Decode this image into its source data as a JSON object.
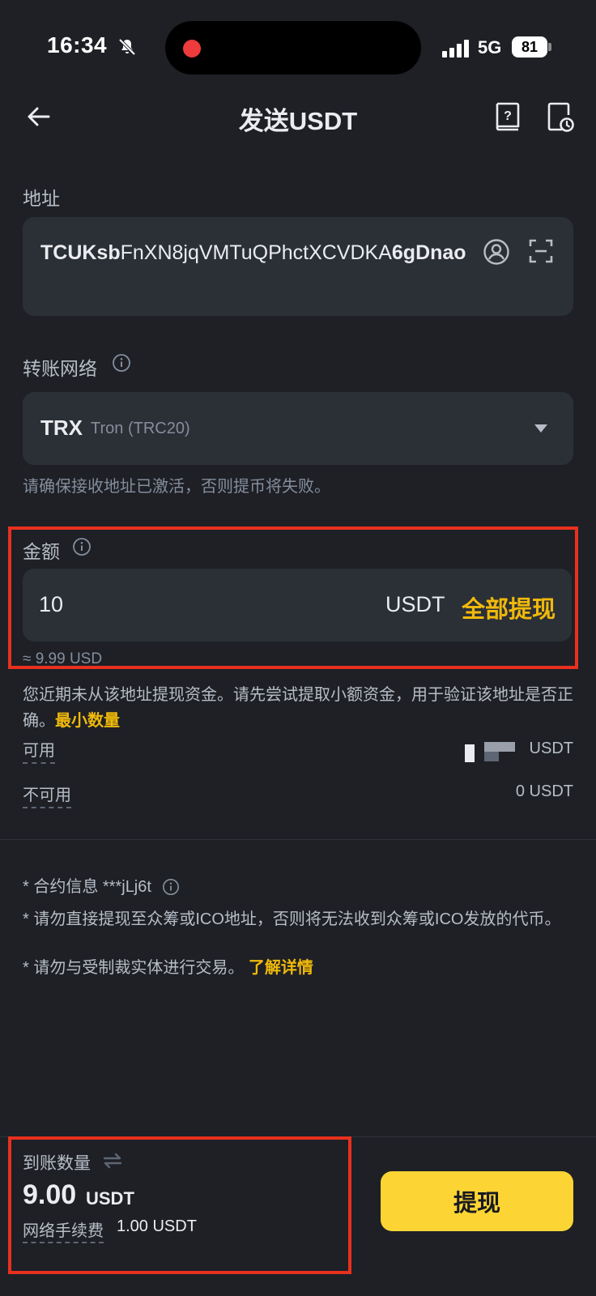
{
  "status_bar": {
    "time": "16:34",
    "network": "5G",
    "battery": "81",
    "icons": [
      "bell-off-icon",
      "recording-dot-icon",
      "signal-icon",
      "battery-icon"
    ]
  },
  "header": {
    "title": "发送USDT",
    "icons": [
      "back-arrow-icon",
      "help-book-icon",
      "history-icon"
    ]
  },
  "address": {
    "label": "地址",
    "value_prefix": "TCUKsb",
    "value_middle": "FnXN8jqVMTuQPhctXCVDKA",
    "value_suffix": "6gDnao",
    "icons": [
      "contact-icon",
      "scan-icon"
    ]
  },
  "network": {
    "label": "转账网络",
    "code": "TRX",
    "name": "Tron (TRC20)",
    "hint": "请确保接收地址已激活，否则提币将失败。"
  },
  "amount": {
    "label": "金额",
    "value": "10",
    "unit": "USDT",
    "max_label": "全部提现",
    "usd_equivalent": "≈ 9.99 USD"
  },
  "warning": {
    "text": "您近期未从该地址提现资金。请先尝试提取小额资金，用于验证该地址是否正确。",
    "link": "最小数量"
  },
  "balances": {
    "available_label": "可用",
    "available_unit": "USDT",
    "unavailable_label": "不可用",
    "unavailable_value": "0 USDT"
  },
  "notes": {
    "contract_label": "* 合约信息 ***jLj6t",
    "crowdfund_warning": "* 请勿直接提现至众筹或ICO地址，否则将无法收到众筹或ICO发放的代币。",
    "sanction_warning": "* 请勿与受制裁实体进行交易。",
    "learn_more": "了解详情"
  },
  "receive": {
    "label": "到账数量",
    "amount": "9.00",
    "unit": "USDT",
    "fee_label": "网络手续费",
    "fee_value": "1.00 USDT"
  },
  "withdraw_button": "提现",
  "colors": {
    "background": "#1e2026",
    "card": "#2b2f36",
    "accent": "#f0b90b",
    "button": "#fcd535",
    "highlight": "#e8301e"
  }
}
